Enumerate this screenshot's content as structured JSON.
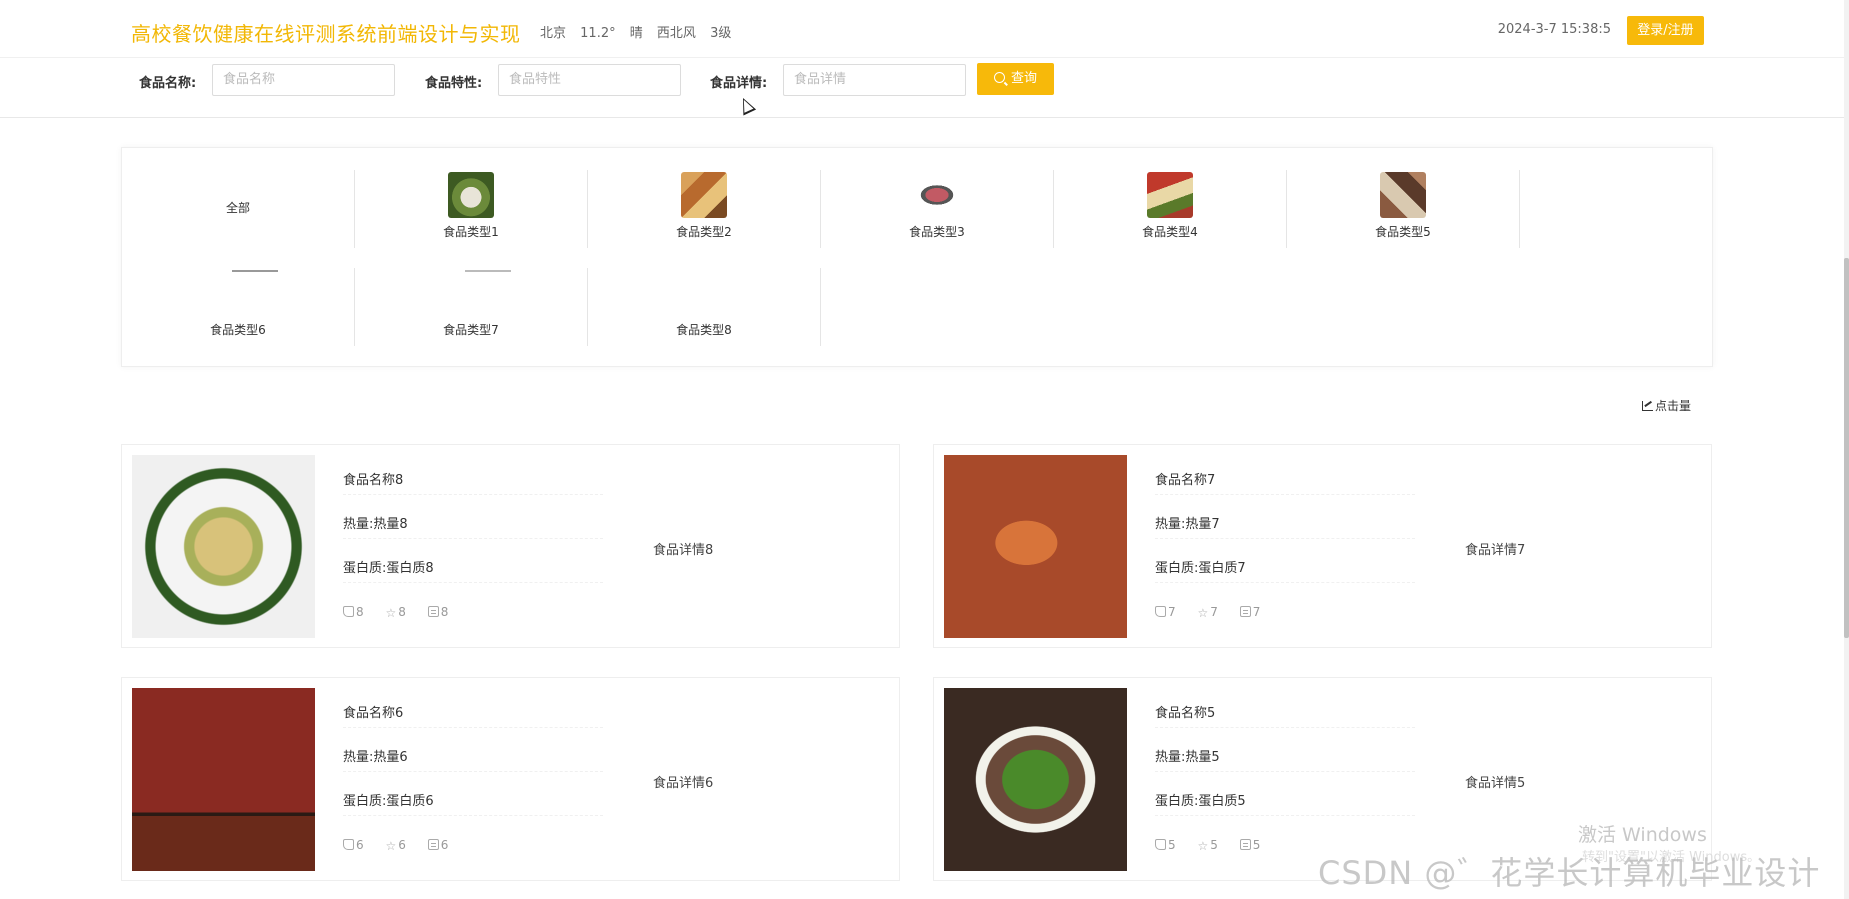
{
  "header": {
    "title": "高校餐饮健康在线评测系统前端设计与实现",
    "weather": {
      "city": "北京",
      "temp": "11.2°",
      "condition": "晴",
      "wind": "西北风",
      "level": "3级"
    },
    "datetime": "2024-3-7 15:38:5",
    "login_label": "登录/注册"
  },
  "search": {
    "name_label": "食品名称:",
    "name_placeholder": "食品名称",
    "feature_label": "食品特性:",
    "feature_placeholder": "食品特性",
    "detail_label": "食品详情:",
    "detail_placeholder": "食品详情",
    "button_label": "查询"
  },
  "categories": [
    {
      "label": "全部"
    },
    {
      "label": "食品类型1",
      "color": "#6b8a3a"
    },
    {
      "label": "食品类型2",
      "color": "#b86a2e"
    },
    {
      "label": "食品类型3",
      "color": "#c25a64"
    },
    {
      "label": "食品类型4",
      "color": "#a83a2a"
    },
    {
      "label": "食品类型5",
      "color": "#8a5a40"
    },
    {
      "label": "食品类型6"
    },
    {
      "label": "食品类型7"
    },
    {
      "label": "食品类型8"
    }
  ],
  "sort_label": "点击量",
  "foods": [
    {
      "name": "食品名称8",
      "heat": "热量:热量8",
      "protein": "蛋白质:蛋白质8",
      "detail": "食品详情8",
      "likes": "8",
      "favs": "8",
      "comments": "8"
    },
    {
      "name": "食品名称7",
      "heat": "热量:热量7",
      "protein": "蛋白质:蛋白质7",
      "detail": "食品详情7",
      "likes": "7",
      "favs": "7",
      "comments": "7"
    },
    {
      "name": "食品名称6",
      "heat": "热量:热量6",
      "protein": "蛋白质:蛋白质6",
      "detail": "食品详情6",
      "likes": "6",
      "favs": "6",
      "comments": "6"
    },
    {
      "name": "食品名称5",
      "heat": "热量:热量5",
      "protein": "蛋白质:蛋白质5",
      "detail": "食品详情5",
      "likes": "5",
      "favs": "5",
      "comments": "5"
    }
  ],
  "watermark": {
    "windows": "激活 Windows",
    "windows_sub": "转到\"设置\"以激活 Windows。",
    "csdn": "CSDN @゛花学长计算机毕业设计"
  },
  "colors": {
    "accent": "#f7b90a",
    "title": "#f2b705"
  }
}
